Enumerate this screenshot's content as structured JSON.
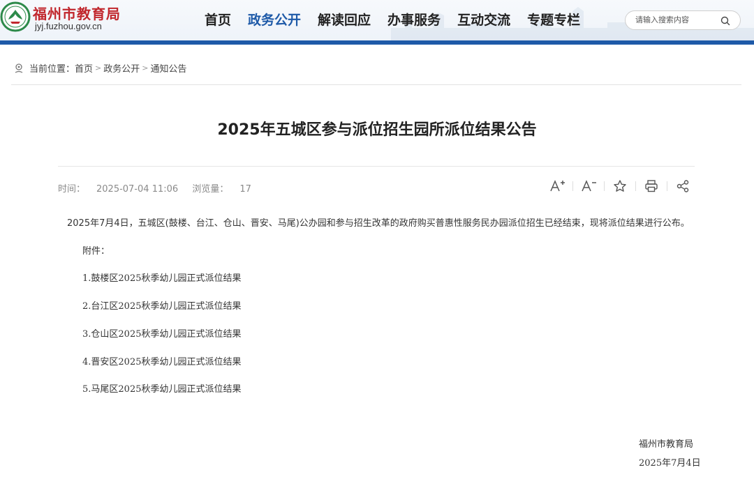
{
  "site": {
    "name": "福州市教育局",
    "url": "jyj.fuzhou.gov.cn"
  },
  "nav": {
    "items": [
      "首页",
      "政务公开",
      "解读回应",
      "办事服务",
      "互动交流",
      "专题专栏"
    ],
    "active": "政务公开"
  },
  "search": {
    "placeholder": "请输入搜索内容",
    "icon": "search-icon"
  },
  "breadcrumb": {
    "prefix": "当前位置：",
    "items": [
      "首页",
      "政务公开",
      "通知公告"
    ],
    "separator": ">"
  },
  "article": {
    "title": "2025年五城区参与派位招生园所派位结果公告",
    "time_label": "时间：",
    "time": "2025-07-04 11:06",
    "views_label": "浏览量：",
    "views": "17",
    "tools": [
      "font-increase-icon",
      "font-decrease-icon",
      "star-icon",
      "print-icon",
      "share-icon"
    ],
    "intro": "2025年7月4日，五城区(鼓楼、台江、仓山、晋安、马尾)公办园和参与招生改革的政府购买普惠性服务民办园派位招生已经结束，现将派位结果进行公布。",
    "attachments_label": "附件：",
    "attachments": [
      "1.鼓楼区2025秋季幼儿园正式派位结果",
      "2.台江区2025秋季幼儿园正式派位结果",
      "3.仓山区2025秋季幼儿园正式派位结果",
      "4.晋安区2025秋季幼儿园正式派位结果",
      "5.马尾区2025秋季幼儿园正式派位结果"
    ],
    "signature": "福州市教育局",
    "date": "2025年7月4日"
  },
  "colors": {
    "brand_blue": "#1e5aa8",
    "logo_red": "#c1272d"
  }
}
